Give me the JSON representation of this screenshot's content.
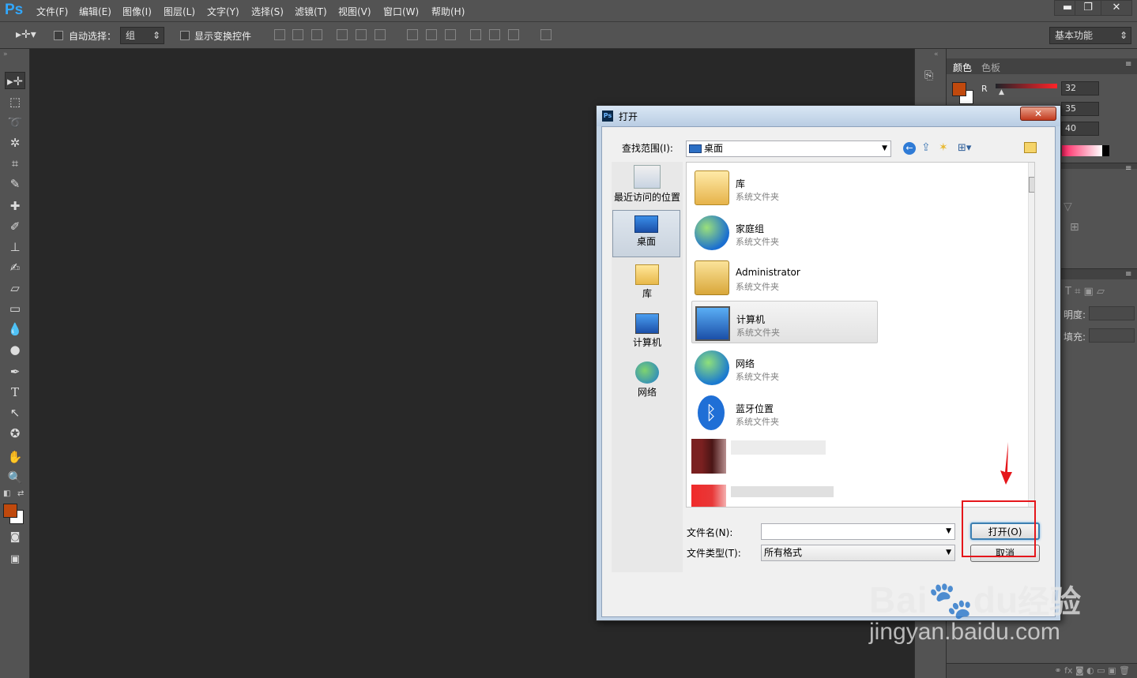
{
  "app": {
    "logo": "Ps"
  },
  "menu": [
    "文件(F)",
    "编辑(E)",
    "图像(I)",
    "图层(L)",
    "文字(Y)",
    "选择(S)",
    "滤镜(T)",
    "视图(V)",
    "窗口(W)",
    "帮助(H)"
  ],
  "window_controls": {
    "minimize": "▬",
    "restore": "❐",
    "close": "✕"
  },
  "options": {
    "auto_select_label": "自动选择：",
    "auto_select_value": "组",
    "show_transform_label": "显示变换控件",
    "workspace": "基本功能"
  },
  "right_panel": {
    "tabs": [
      "颜色",
      "色板"
    ],
    "channel_label": "R",
    "values": [
      "32",
      "35",
      "40"
    ],
    "opacity_label": "明度:",
    "fill_label": "填充:"
  },
  "colors": {
    "foreground": "#c0490d",
    "background": "#ffffff",
    "accent": "#31a8ff",
    "highlight_box": "#e5161b"
  },
  "dialog": {
    "title": "打开",
    "lookin_label": "查找范围(I):",
    "lookin_value": "桌面",
    "places": [
      "最近访问的位置",
      "桌面",
      "库",
      "计算机",
      "网络"
    ],
    "files": [
      {
        "name": "库",
        "type": "系统文件夹",
        "icon": "library-icon"
      },
      {
        "name": "家庭组",
        "type": "系统文件夹",
        "icon": "homegroup-icon"
      },
      {
        "name": "Administrator",
        "type": "系统文件夹",
        "icon": "user-folder-icon"
      },
      {
        "name": "计算机",
        "type": "系统文件夹",
        "icon": "computer-icon"
      },
      {
        "name": "网络",
        "type": "系统文件夹",
        "icon": "network-icon"
      },
      {
        "name": "蓝牙位置",
        "type": "系统文件夹",
        "icon": "bluetooth-icon"
      }
    ],
    "filename_label": "文件名(N):",
    "filename_value": "",
    "filetype_label": "文件类型(T):",
    "filetype_value": "所有格式",
    "open_button": "打开(O)",
    "cancel_button": "取消"
  },
  "watermark": {
    "line1": "Bai",
    "line2": "du",
    "line3": "经验",
    "url": "jingyan.baidu.com"
  }
}
